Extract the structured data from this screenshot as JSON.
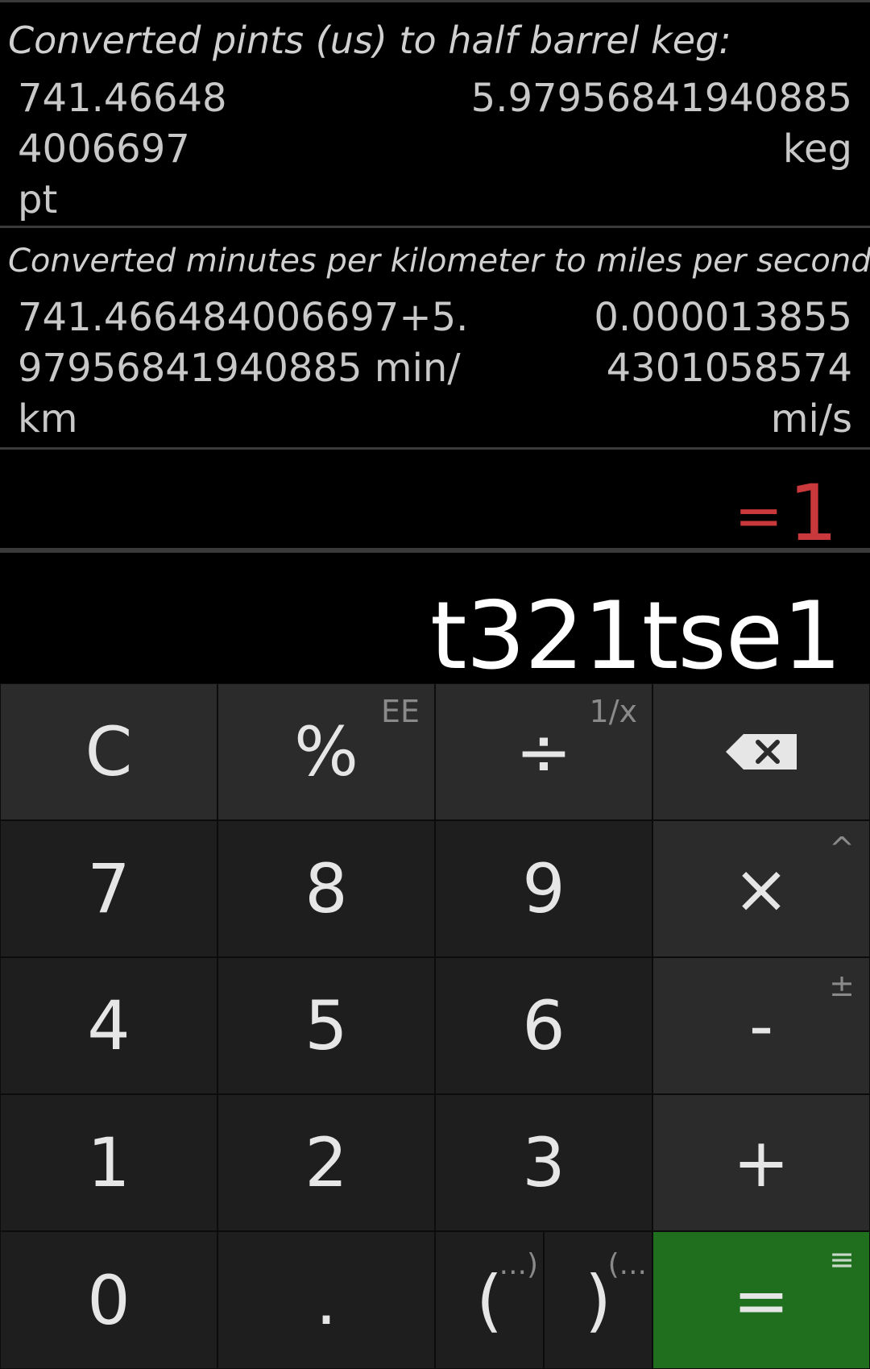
{
  "history": [
    {
      "title": "Converted pints (us) to half barrel keg:",
      "left_lines": [
        "741.46648",
        "4006697",
        "pt"
      ],
      "right_lines": [
        "5.97956841940885",
        "keg"
      ]
    },
    {
      "title": "Converted minutes per kilometer to miles per second:",
      "left_lines": [
        "741.466484006697+5.",
        "97956841940885 min/",
        "km"
      ],
      "right_lines": [
        "0.000013855",
        "4301058574",
        "mi/s"
      ]
    }
  ],
  "result": {
    "equals_sign": "=",
    "value": "1"
  },
  "input": {
    "expression": "t321tse1"
  },
  "keys": {
    "clear": "C",
    "percent": "%",
    "percent_alt": "EE",
    "divide": "÷",
    "divide_alt": "1/x",
    "seven": "7",
    "eight": "8",
    "nine": "9",
    "multiply": "×",
    "multiply_alt": "^",
    "four": "4",
    "five": "5",
    "six": "6",
    "minus": "-",
    "minus_alt": "±",
    "one": "1",
    "two": "2",
    "three": "3",
    "plus": "+",
    "zero": "0",
    "dot": ".",
    "open_paren": "(",
    "open_paren_alt": "...)",
    "close_paren": ")",
    "close_paren_alt": "(...",
    "equals": "=",
    "equals_alt": "≡"
  },
  "colors": {
    "result": "#c9383a",
    "equals_key": "#1f6f1f",
    "top_key": "#2b2b2b",
    "key": "#1e1e1e"
  },
  "icons": {
    "backspace": "backspace-icon"
  }
}
